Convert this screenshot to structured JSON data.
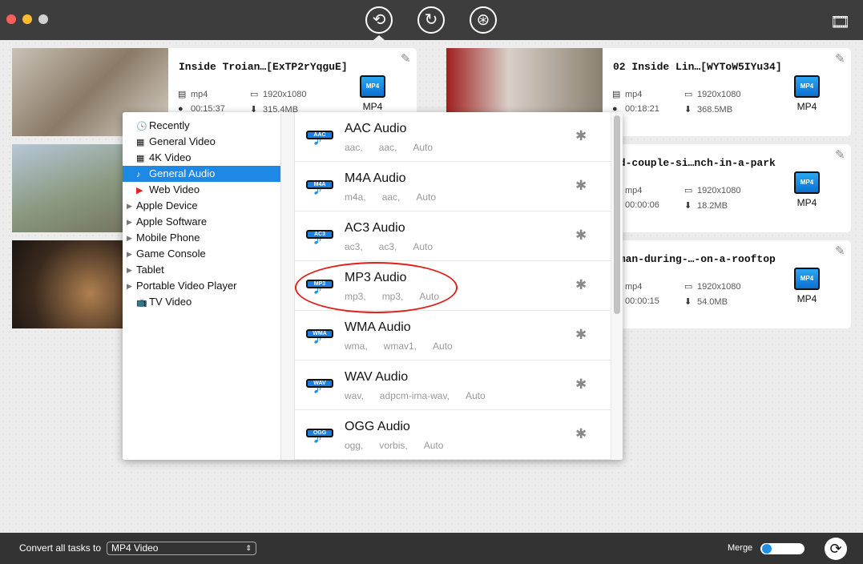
{
  "toolbar": {
    "icons": [
      "convert-icon",
      "rotate-convert-icon",
      "video-download-icon",
      "media-library-icon"
    ]
  },
  "tasks": [
    {
      "title": "Inside Troian…[ExTP2rYqguE]",
      "container": "mp4",
      "resolution": "1920x1080",
      "duration": "00:15:37",
      "size": "315.4MB",
      "format": "MP4"
    },
    {
      "title": "",
      "container": "",
      "resolution": "",
      "duration": "",
      "size": "",
      "format": ""
    },
    {
      "title": "",
      "container": "",
      "resolution": "",
      "duration": "",
      "size": "",
      "format": ""
    },
    {
      "title": "02 Inside Lin…[WYToW5IYu34]",
      "container": "mp4",
      "resolution": "1920x1080",
      "duration": "00:18:21",
      "size": "368.5MB",
      "format": "MP4"
    },
    {
      "title": "ld-couple-si…nch-in-a-park",
      "container": "mp4",
      "resolution": "1920x1080",
      "duration": "00:00:06",
      "size": "18.2MB",
      "format": "MP4"
    },
    {
      "title": "oman-during-…-on-a-rooftop",
      "container": "mp4",
      "resolution": "1920x1080",
      "duration": "00:00:15",
      "size": "54.0MB",
      "format": "MP4"
    }
  ],
  "categories": [
    {
      "label": "Recently",
      "icon": "clock-icon"
    },
    {
      "label": "General Video",
      "icon": "film-icon"
    },
    {
      "label": "4K Video",
      "icon": "4k-film-icon"
    },
    {
      "label": "General Audio",
      "icon": "music-note-icon",
      "selected": true
    },
    {
      "label": "Web Video",
      "icon": "youtube-icon"
    },
    {
      "label": "Apple Device",
      "expandable": true
    },
    {
      "label": "Apple Software",
      "expandable": true
    },
    {
      "label": "Mobile Phone",
      "expandable": true
    },
    {
      "label": "Game Console",
      "expandable": true
    },
    {
      "label": "Tablet",
      "expandable": true
    },
    {
      "label": "Portable Video Player",
      "expandable": true
    },
    {
      "label": "TV Video",
      "icon": "tv-icon"
    }
  ],
  "formats": [
    {
      "name": "AAC Audio",
      "badge": "AAC",
      "ext": "aac,",
      "codec": "aac,",
      "quality": "Auto"
    },
    {
      "name": "M4A Audio",
      "badge": "M4A",
      "ext": "m4a,",
      "codec": "aac,",
      "quality": "Auto"
    },
    {
      "name": "AC3 Audio",
      "badge": "AC3",
      "ext": "ac3,",
      "codec": "ac3,",
      "quality": "Auto"
    },
    {
      "name": "MP3 Audio",
      "badge": "MP3",
      "ext": "mp3,",
      "codec": "mp3,",
      "quality": "Auto",
      "highlighted": true
    },
    {
      "name": "WMA Audio",
      "badge": "WMA",
      "ext": "wma,",
      "codec": "wmav1,",
      "quality": "Auto"
    },
    {
      "name": "WAV Audio",
      "badge": "WAV",
      "ext": "wav,",
      "codec": "adpcm-ima-wav,",
      "quality": "Auto"
    },
    {
      "name": "OGG Audio",
      "badge": "OGG",
      "ext": "ogg,",
      "codec": "vorbis,",
      "quality": "Auto"
    }
  ],
  "footer": {
    "convert_label": "Convert all tasks to",
    "convert_value": "MP4 Video",
    "merge_label": "Merge",
    "merge_on": false
  },
  "colors": {
    "accent": "#1e88e5",
    "highlight_ellipse": "#e0201c",
    "titlebar": "#3d3d3d"
  }
}
